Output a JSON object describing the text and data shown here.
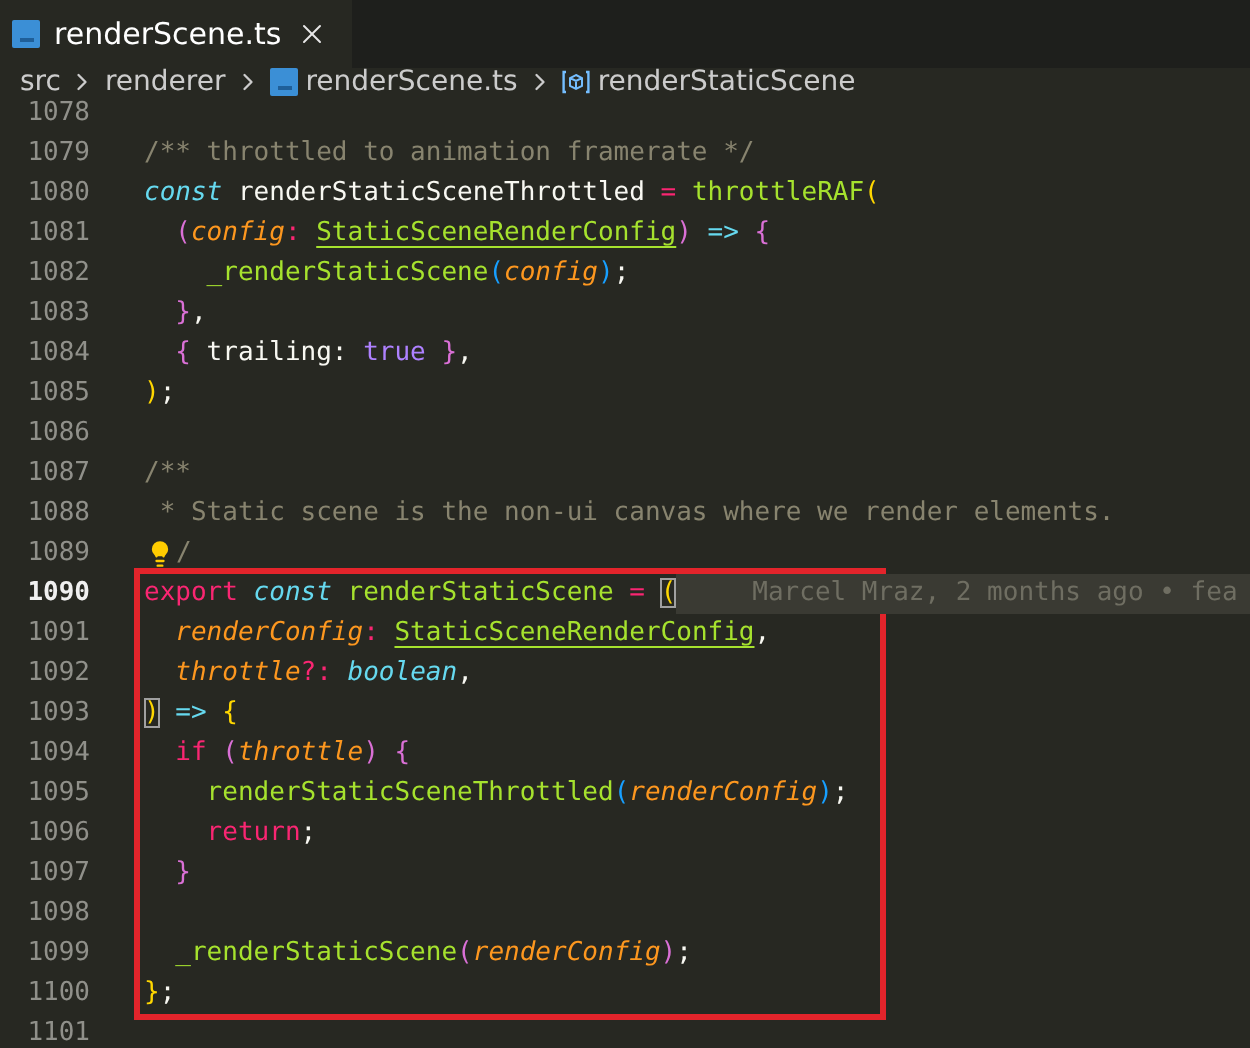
{
  "tabs": [
    {
      "label": "renderScene.ts",
      "selected": true
    }
  ],
  "breadcrumbs": [
    {
      "kind": "folder",
      "label": "src"
    },
    {
      "kind": "folder",
      "label": "renderer"
    },
    {
      "kind": "file",
      "label": "renderScene.ts"
    },
    {
      "kind": "symbol",
      "label": "renderStaticScene"
    }
  ],
  "editor": {
    "blocks": [
      {
        "framed": false,
        "lines": [
          {
            "number": "1078",
            "current": false,
            "lightbulb": false
          },
          {
            "number": "1079",
            "current": false,
            "lightbulb": false,
            "tokens": [
              {
                "kind": "comment",
                "text": "/** throttled to animation framerate */"
              }
            ]
          },
          {
            "number": "1080",
            "current": false,
            "lightbulb": false,
            "tokens": [
              {
                "kind": "storage",
                "text": "const"
              },
              {
                "kind": "plain",
                "text": " renderStaticSceneThrottled "
              },
              {
                "kind": "operator",
                "text": "= "
              },
              {
                "kind": "function",
                "text": "throttleRAF"
              },
              {
                "kind": "bracket1",
                "text": "("
              }
            ]
          },
          {
            "number": "1081",
            "current": false,
            "lightbulb": false,
            "tokens": [
              {
                "kind": "bracket2",
                "text": "  ("
              },
              {
                "kind": "parameter",
                "text": "config"
              },
              {
                "kind": "operator",
                "text": ": "
              },
              {
                "kind": "type",
                "text": "StaticSceneRenderConfig"
              },
              {
                "kind": "bracket2",
                "text": ") "
              },
              {
                "kind": "arrow",
                "text": "=> "
              },
              {
                "kind": "bracket2",
                "text": "{"
              }
            ]
          },
          {
            "number": "1082",
            "current": false,
            "lightbulb": false,
            "tokens": [
              {
                "kind": "function",
                "text": "    _renderStaticScene"
              },
              {
                "kind": "bracket3",
                "text": "("
              },
              {
                "kind": "parameter",
                "text": "config"
              },
              {
                "kind": "bracket3",
                "text": ")"
              },
              {
                "kind": "plain",
                "text": ";"
              }
            ]
          },
          {
            "number": "1083",
            "current": false,
            "lightbulb": false,
            "tokens": [
              {
                "kind": "bracket2",
                "text": "  }"
              },
              {
                "kind": "plain",
                "text": ","
              }
            ]
          },
          {
            "number": "1084",
            "current": false,
            "lightbulb": false,
            "tokens": [
              {
                "kind": "bracket2",
                "text": "  {"
              },
              {
                "kind": "plain",
                "text": " trailing: "
              },
              {
                "kind": "constant",
                "text": "true "
              },
              {
                "kind": "bracket2",
                "text": "}"
              },
              {
                "kind": "plain",
                "text": ","
              }
            ]
          },
          {
            "number": "1085",
            "current": false,
            "lightbulb": false,
            "tokens": [
              {
                "kind": "bracket1",
                "text": ")"
              },
              {
                "kind": "plain",
                "text": ";"
              }
            ]
          },
          {
            "number": "1086",
            "current": false,
            "lightbulb": false
          },
          {
            "number": "1087",
            "current": false,
            "lightbulb": false,
            "tokens": [
              {
                "kind": "comment",
                "text": "/**"
              }
            ]
          },
          {
            "number": "1088",
            "current": false,
            "lightbulb": false,
            "tokens": [
              {
                "kind": "comment",
                "text": " * Static scene is the non-ui canvas where we render elements."
              }
            ]
          },
          {
            "number": "1089",
            "current": false,
            "lightbulb": true,
            "tokens": [
              {
                "kind": "comment",
                "text": "/"
              }
            ]
          }
        ]
      },
      {
        "framed": true,
        "lines": [
          {
            "number": "1090",
            "current": true,
            "lightbulb": false,
            "blame": "Marcel Mraz, 2 months ago • fea",
            "tokens": [
              {
                "kind": "keyword",
                "text": "export "
              },
              {
                "kind": "storage",
                "text": "const "
              },
              {
                "kind": "function",
                "text": "renderStaticScene "
              },
              {
                "kind": "operator",
                "text": "= "
              },
              {
                "kind": "bracket-match",
                "text": "("
              }
            ]
          },
          {
            "number": "1091",
            "current": false,
            "lightbulb": false,
            "tokens": [
              {
                "kind": "parameter",
                "text": "  renderConfig"
              },
              {
                "kind": "operator",
                "text": ": "
              },
              {
                "kind": "type",
                "text": "StaticSceneRenderConfig"
              },
              {
                "kind": "plain",
                "text": ","
              }
            ]
          },
          {
            "number": "1092",
            "current": false,
            "lightbulb": false,
            "tokens": [
              {
                "kind": "parameter",
                "text": "  throttle"
              },
              {
                "kind": "operator",
                "text": "?: "
              },
              {
                "kind": "builtin",
                "text": "boolean"
              },
              {
                "kind": "plain",
                "text": ","
              }
            ]
          },
          {
            "number": "1093",
            "current": false,
            "lightbulb": false,
            "tokens": [
              {
                "kind": "bracket-match",
                "text": ")"
              },
              {
                "kind": "arrow",
                "text": " => "
              },
              {
                "kind": "bracket1",
                "text": "{"
              }
            ]
          },
          {
            "number": "1094",
            "current": false,
            "lightbulb": false,
            "tokens": [
              {
                "kind": "keyword",
                "text": "  if "
              },
              {
                "kind": "bracket2",
                "text": "("
              },
              {
                "kind": "parameter",
                "text": "throttle"
              },
              {
                "kind": "bracket2",
                "text": ") {"
              }
            ]
          },
          {
            "number": "1095",
            "current": false,
            "lightbulb": false,
            "tokens": [
              {
                "kind": "function",
                "text": "    renderStaticSceneThrottled"
              },
              {
                "kind": "bracket3",
                "text": "("
              },
              {
                "kind": "parameter",
                "text": "renderConfig"
              },
              {
                "kind": "bracket3",
                "text": ")"
              },
              {
                "kind": "plain",
                "text": ";"
              }
            ]
          },
          {
            "number": "1096",
            "current": false,
            "lightbulb": false,
            "tokens": [
              {
                "kind": "keyword",
                "text": "    return"
              },
              {
                "kind": "plain",
                "text": ";"
              }
            ]
          },
          {
            "number": "1097",
            "current": false,
            "lightbulb": false,
            "tokens": [
              {
                "kind": "bracket2",
                "text": "  }"
              }
            ]
          },
          {
            "number": "1098",
            "current": false,
            "lightbulb": false
          },
          {
            "number": "1099",
            "current": false,
            "lightbulb": false,
            "tokens": [
              {
                "kind": "function",
                "text": "  _renderStaticScene"
              },
              {
                "kind": "bracket2",
                "text": "("
              },
              {
                "kind": "parameter",
                "text": "renderConfig"
              },
              {
                "kind": "bracket2",
                "text": ")"
              },
              {
                "kind": "plain",
                "text": ";"
              }
            ]
          },
          {
            "number": "1100",
            "current": false,
            "lightbulb": false,
            "tokens": [
              {
                "kind": "bracket1",
                "text": "}"
              },
              {
                "kind": "plain",
                "text": ";"
              }
            ]
          }
        ]
      },
      {
        "framed": false,
        "lines": [
          {
            "number": "1101",
            "current": false,
            "lightbulb": false
          }
        ]
      }
    ]
  }
}
